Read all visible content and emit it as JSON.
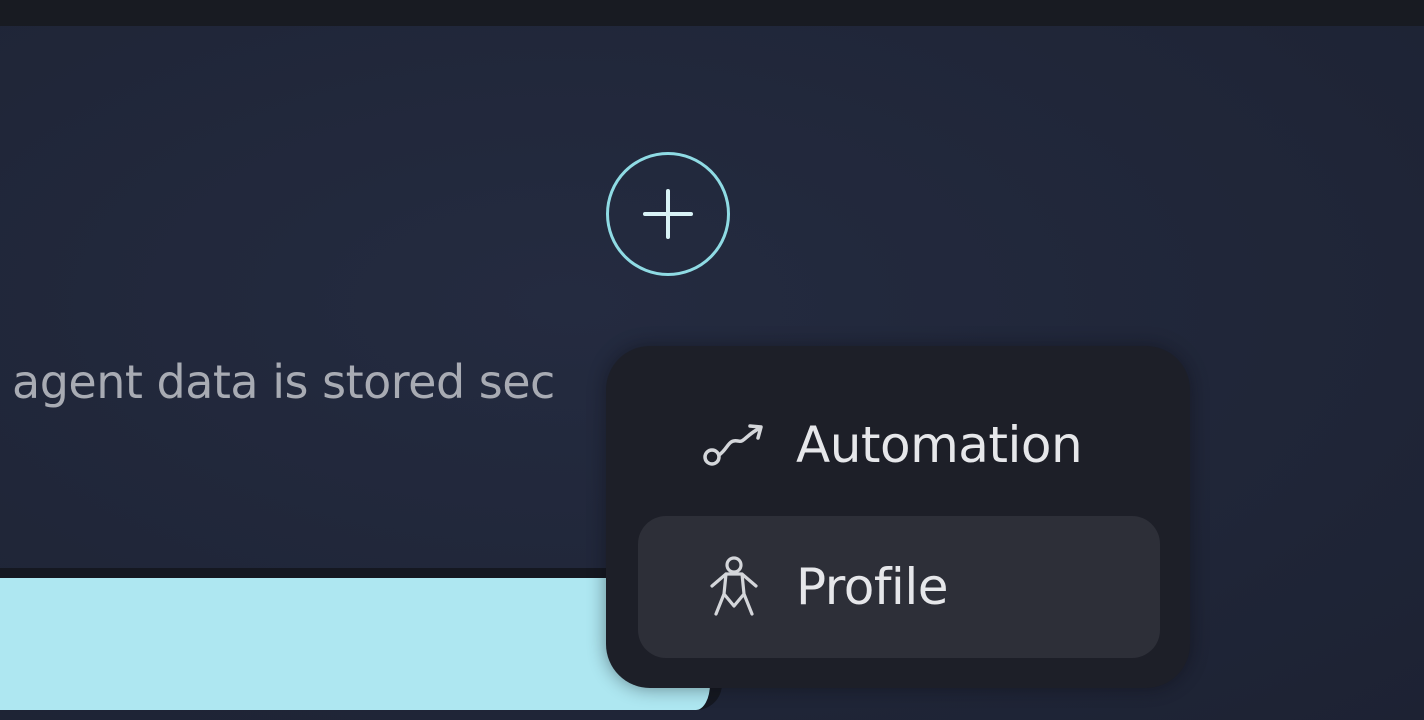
{
  "info_text": "agent data is stored sec",
  "add_button": {
    "icon": "plus-icon",
    "accent_color": "#8fdbe4"
  },
  "menu": {
    "items": [
      {
        "label": "Automation",
        "icon": "automation-icon",
        "highlighted": false
      },
      {
        "label": "Profile",
        "icon": "person-icon",
        "highlighted": true
      }
    ]
  },
  "colors": {
    "background": "#202639",
    "menu_background": "#1d1f28",
    "menu_highlight": "#2d2f38",
    "input_bar": "#aee7f1",
    "text_muted": "#a8abb3",
    "text_menu": "#e6e7ea"
  }
}
